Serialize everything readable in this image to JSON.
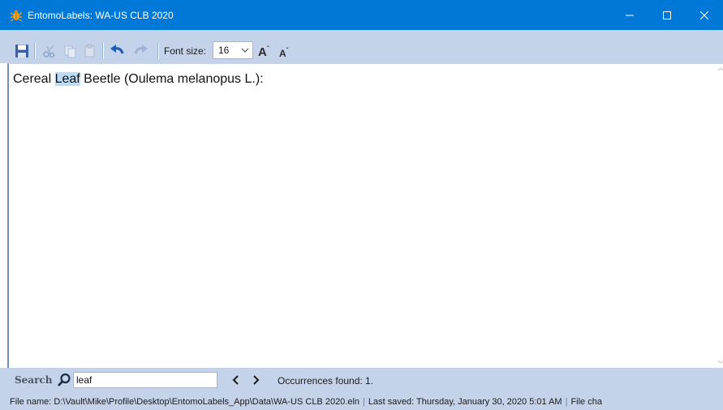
{
  "window": {
    "title": "EntomoLabels: WA-US CLB 2020",
    "icon": "bug-icon",
    "controls": [
      "minimize-icon",
      "maximize-icon",
      "close-icon"
    ]
  },
  "toolbar": {
    "icons": [
      "save-icon",
      "cut-icon",
      "copy-icon",
      "paste-icon",
      "undo-icon",
      "redo-icon",
      "grow-font-icon",
      "shrink-font-icon"
    ],
    "font_size_label": "Font size:",
    "font_size_value": "16",
    "grow_font_label": "A",
    "shrink_font_label": "A"
  },
  "editor": {
    "text_before": "Cereal ",
    "highlighted": "Leaf",
    "text_after": " Beetle (Oulema melanopus L.):"
  },
  "search": {
    "label": "Search",
    "value": "leaf",
    "occurrences": "Occurrences found: 1."
  },
  "status": {
    "file_name": "File name: D:\\Vault\\Mike\\Profile\\Desktop\\EntomoLabels_App\\Data\\WA-US CLB 2020.eln",
    "last_saved": "Last saved: Thursday, January 30, 2020 5:01 AM",
    "file_changed": "File cha"
  },
  "colors": {
    "titlebar": "#0078d7",
    "toolbar": "#c5d3ea",
    "highlight": "#bcdcf5",
    "editor_border": "#6e8fc8"
  }
}
